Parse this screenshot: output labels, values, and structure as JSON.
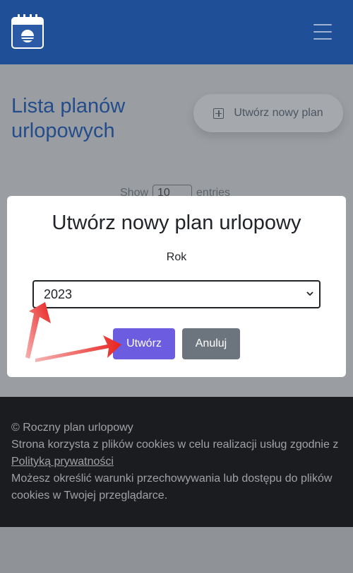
{
  "header": {
    "logo_icon": "calendar-sun-logo",
    "menu_icon": "hamburger-menu-icon"
  },
  "page": {
    "title": "Lista planów urlopowych",
    "create_button_label": "Utwórz nowy plan",
    "show_label": "Show",
    "entries_value": "10",
    "entries_label": "entries"
  },
  "modal": {
    "title": "Utwórz nowy plan urlopowy",
    "year_label": "Rok",
    "year_value": "2023",
    "create_label": "Utwórz",
    "cancel_label": "Anuluj"
  },
  "footer": {
    "copyright": "© Roczny plan urlopowy",
    "cookies_line": "Strona korzysta z plików cookies w celu realizacji usług zgodnie z",
    "privacy_link": "Polityką prywatności",
    "browser_line": "Możesz określić warunki przechowywania lub dostępu do plików cookies w Twojej przeglądarce."
  },
  "colors": {
    "header_bg": "#1e4f97",
    "primary_purple": "#6c5ce0",
    "secondary_gray": "#6c757d",
    "annotation_red": "#e8231f"
  }
}
